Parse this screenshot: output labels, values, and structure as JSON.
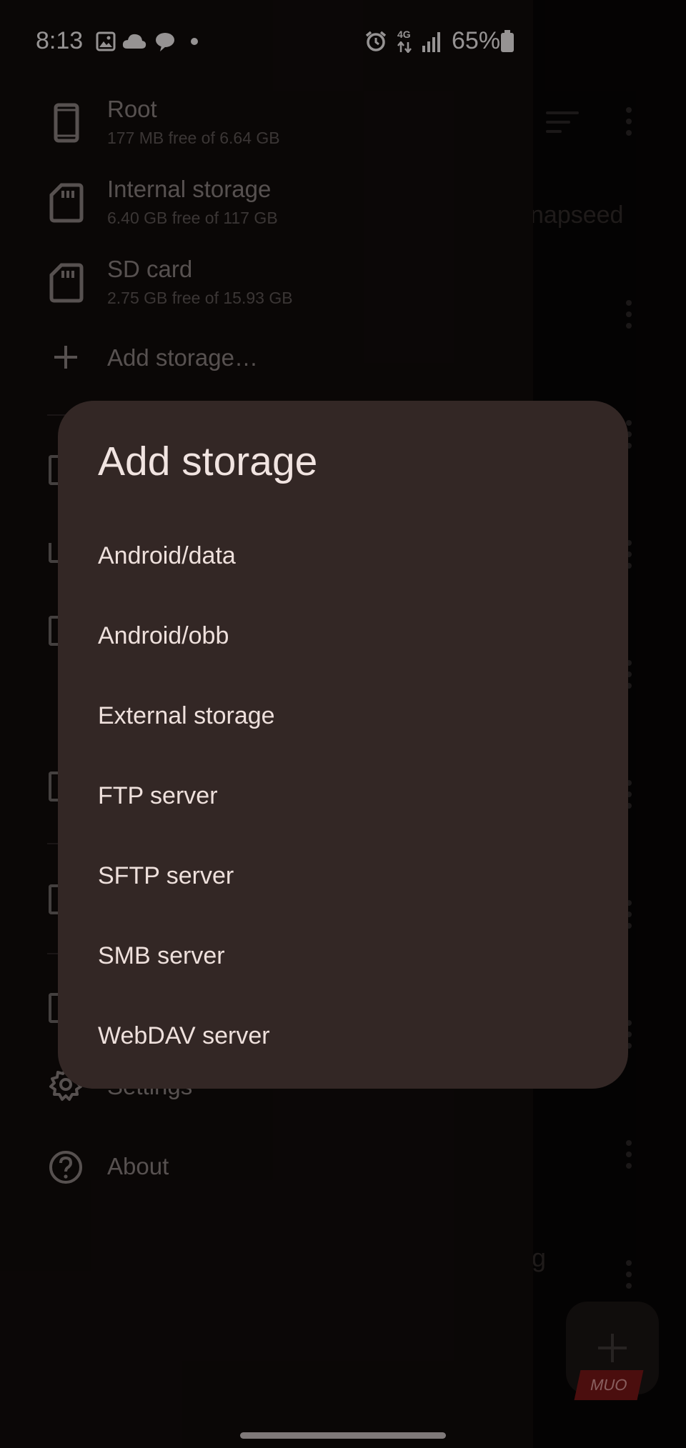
{
  "status_bar": {
    "time": "8:13",
    "network": "4G",
    "battery": "65%"
  },
  "background": {
    "partial_text_1": "napseed",
    "partial_text_2": "g",
    "watermark": "MUO"
  },
  "drawer": {
    "storages": [
      {
        "title": "Root",
        "subtitle": "177 MB free of 6.64 GB",
        "icon": "phone-icon"
      },
      {
        "title": "Internal storage",
        "subtitle": "6.40 GB free of 117 GB",
        "icon": "sd-card-icon"
      },
      {
        "title": "SD card",
        "subtitle": "2.75 GB free of 15.93 GB",
        "icon": "sd-card-icon"
      }
    ],
    "add_storage": "Add storage…",
    "settings": "Settings",
    "about": "About"
  },
  "dialog": {
    "title": "Add storage",
    "options": [
      "Android/data",
      "Android/obb",
      "External storage",
      "FTP server",
      "SFTP server",
      "SMB server",
      "WebDAV server"
    ]
  },
  "colors": {
    "drawer_bg": "#110c0b",
    "dialog_bg": "#332725",
    "dialog_text": "#eee0dc"
  }
}
